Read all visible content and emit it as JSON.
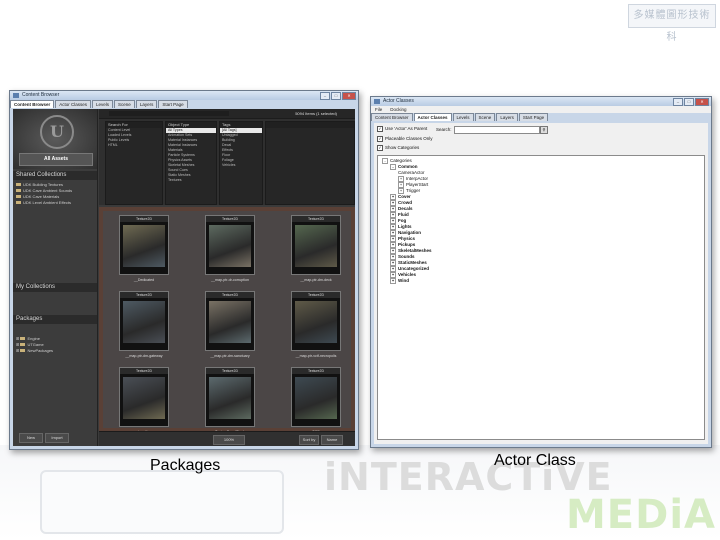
{
  "slide": {
    "caption_left": "Packages",
    "caption_right": "Actor Class",
    "logo_text_1": "iNTERACTiVE",
    "logo_text_2": "MEDiA",
    "stamp_text": "多媒體圖形技術科"
  },
  "content_browser": {
    "title": "Content Browser",
    "tabs": [
      "Content Browser",
      "Actor Classes",
      "Levels",
      "Scene",
      "Layers",
      "Start Page"
    ],
    "all_assets": "All Assets",
    "shared_collections_label": "Shared Collections",
    "shared_collections": [
      "UDK Building Textures",
      "UDK Cave Ambient Sounds",
      "UDK Cave Materials",
      "UDK Level Ambient Effects"
    ],
    "my_collections_label": "My Collections",
    "packages_label": "Packages",
    "packages": [
      "Engine",
      "UTGame",
      "NewPackages"
    ],
    "result_count": "5094 Items (1 selected)",
    "filter_columns": [
      {
        "header": "Search For",
        "items": [
          "Content Level",
          "Loaded Levels",
          "Public Levels",
          "HTML"
        ]
      },
      {
        "header": "Object Type",
        "items": [
          "All Types",
          "Animation Sets",
          "Material Instances",
          "Material Instances",
          "Materials",
          "Particle Systems",
          "Physics Assets",
          "Skeletal Meshes",
          "Sound Cues",
          "Static Meshes",
          "Textures"
        ]
      },
      {
        "header": "Tags",
        "items": [
          "[All Tags]",
          "Untagged",
          "Building",
          "Decal",
          "Effects",
          "Floor",
          "Foliage",
          "Vehicles"
        ]
      }
    ],
    "thumbnails": [
      {
        "type": "Texture2D",
        "name": "__Dedicated"
      },
      {
        "type": "Texture2D",
        "name": "__map-ptr-dr-corruption"
      },
      {
        "type": "Texture2D",
        "name": "__map-ptr-dm-deck"
      },
      {
        "type": "Texture2D",
        "name": "__map-ptr-dm-gateway"
      },
      {
        "type": "Texture2D",
        "name": "__map-ptr-dm-sanctuary"
      },
      {
        "type": "Texture2D",
        "name": "__map-ptr-vctf-necropolis"
      },
      {
        "type": "Texture2D",
        "name": "__map-ptr-vctf-suspense"
      },
      {
        "type": "Texture2D",
        "name": "TextureDecalBlack"
      },
      {
        "type": "Texture2D",
        "name": "TCP"
      }
    ],
    "status": {
      "new": "New",
      "import": "Import",
      "zoom": "100%",
      "sort_label": "Sort by",
      "sort_value": "Name"
    }
  },
  "actor_classes": {
    "title": "Actor Classes",
    "menu": [
      "File",
      "Docking"
    ],
    "tabs": [
      "Content Browser",
      "Actor Classes",
      "Levels",
      "Scene",
      "Layers",
      "Start Page"
    ],
    "options": [
      "Use 'Actor' As Parent",
      "Placeable Classes Only",
      "Show Categories"
    ],
    "search_label": "Search:",
    "search_value": "",
    "tree": [
      {
        "label": "Categories",
        "depth": 0,
        "exp": "-"
      },
      {
        "label": "Common",
        "depth": 1,
        "exp": "-"
      },
      {
        "label": "CameraActor",
        "depth": 2,
        "exp": ""
      },
      {
        "label": "InterpActor",
        "depth": 2,
        "exp": "+"
      },
      {
        "label": "PlayerStart",
        "depth": 2,
        "exp": "+"
      },
      {
        "label": "Trigger",
        "depth": 2,
        "exp": "+"
      },
      {
        "label": "Cover",
        "depth": 1,
        "exp": "+"
      },
      {
        "label": "Crowd",
        "depth": 1,
        "exp": "+"
      },
      {
        "label": "Decals",
        "depth": 1,
        "exp": "+"
      },
      {
        "label": "Fluid",
        "depth": 1,
        "exp": "+"
      },
      {
        "label": "Fog",
        "depth": 1,
        "exp": "+"
      },
      {
        "label": "Lights",
        "depth": 1,
        "exp": "+"
      },
      {
        "label": "Navigation",
        "depth": 1,
        "exp": "+"
      },
      {
        "label": "Physics",
        "depth": 1,
        "exp": "+"
      },
      {
        "label": "Pickups",
        "depth": 1,
        "exp": "+"
      },
      {
        "label": "SkeletalMeshes",
        "depth": 1,
        "exp": "+"
      },
      {
        "label": "Sounds",
        "depth": 1,
        "exp": "+"
      },
      {
        "label": "StaticMeshes",
        "depth": 1,
        "exp": "+"
      },
      {
        "label": "Uncategorized",
        "depth": 1,
        "exp": "+"
      },
      {
        "label": "Vehicles",
        "depth": 1,
        "exp": "+"
      },
      {
        "label": "Wind",
        "depth": 1,
        "exp": "+"
      }
    ]
  }
}
